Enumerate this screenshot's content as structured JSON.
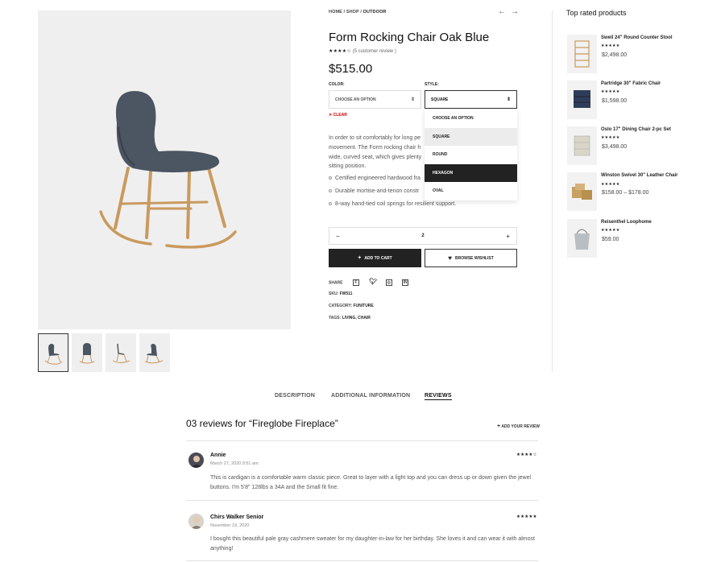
{
  "breadcrumb": {
    "home": "HOME",
    "shop": "SHOP",
    "current": "OUTDOOR",
    "sep": "/"
  },
  "product": {
    "title": "Form Rocking Chair Oak Blue",
    "stars": "★★★★☆",
    "review_count": "(5 customer review )",
    "price": "$515.00",
    "color_label": "COLOR:",
    "color_placeholder": "CHOOSE AN OPTION",
    "style_label": "STYLE:",
    "style_value": "SQUARE",
    "style_options": [
      "CHOOSE AN OPTION",
      "SQUARE",
      "ROUND",
      "HEXAGON",
      "OVAL"
    ],
    "clear_label": "CLEAR",
    "description_lines": [
      "In order to sit comfortably for long pe",
      "movement. The Form rocking chair h",
      "wide, curved seat, which gives plenty",
      "sitting position."
    ],
    "features": [
      "Certified engineered hardwood fra",
      "Durable mortise-and-tenon constr",
      "8-way hand-tied coil springs for resilient support."
    ],
    "quantity": "2",
    "minus": "−",
    "plus": "+",
    "add_to_cart": "ADD TO CART",
    "wishlist": "BROWSE WISHLIST",
    "share_label": "SHARE",
    "sku_label": "SKU:",
    "sku": "FW511",
    "category_label": "CATEGORY:",
    "category": "FUNITURE",
    "tags_label": "TAGS:",
    "tags": "LIVING, CHAIR"
  },
  "sidebar": {
    "title": "Top rated products",
    "items": [
      {
        "name": "Swell 24\" Round Counter Stool",
        "stars": "★★★★★",
        "price": "$2,498.00"
      },
      {
        "name": "Partridge 30\" Fabric Chair",
        "stars": "★★★★★",
        "price": "$1,598.00"
      },
      {
        "name": "Oslo 17\" Dining Chair 2-pc Set",
        "stars": "★★★★★",
        "price": "$3,498.00"
      },
      {
        "name": "Winston Swivel 30\" Leather Chair",
        "stars": "★★★★★",
        "price": "$158.00 – $178.00"
      },
      {
        "name": "Reisenthel Loophome",
        "stars": "★★★★★",
        "price": "$59.00"
      }
    ]
  },
  "tabs": {
    "description": "DESCRIPTION",
    "additional": "ADDITIONAL INFORMATION",
    "reviews": "REVIEWS"
  },
  "reviews": {
    "title": "03 reviews for “Fireglobe Fireplace”",
    "add_label": "ADD YOUR REVIEW",
    "items": [
      {
        "name": "Annie",
        "date": "March 27, 2020 9:51 am",
        "stars": "★★★★☆",
        "text": "This is cardigan is a comfortable warm classic piece. Great to layer with a light top and you can dress up or down given the jewel buttons. I'm 5'8\" 128lbs a 34A and the Small fit fine."
      },
      {
        "name": "Chirs Walker Senior",
        "date": "November 19, 2020",
        "stars": "★★★★★",
        "text": "I bought this beautiful pale gray cashmere sweater for my daughter-in-law for her birthday. She loves it and can wear it with almost anything!"
      }
    ]
  }
}
